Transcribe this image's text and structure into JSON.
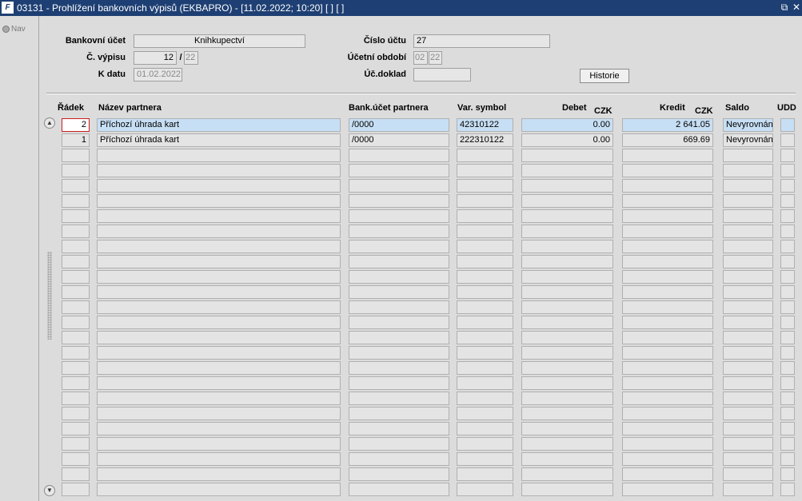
{
  "window": {
    "title": "03131 - Prohlížení bankovních výpisů (EKBAPRO) - [11.02.2022; 10:20]  [ ]  [ ]",
    "logo": "F",
    "icons": [
      "restore-icon",
      "close-icon"
    ]
  },
  "nav": {
    "label": "Nav"
  },
  "form": {
    "bank_account_label": "Bankovní účet",
    "bank_account_value": "Knihkupectví",
    "account_number_label": "Číslo účtu",
    "account_number_value": "27",
    "statement_no_label": "Č. výpisu",
    "statement_no_value": "12",
    "statement_slash": "/",
    "statement_year_value": "22",
    "period_label": "Účetní období",
    "period_month_value": "02",
    "period_year_value": "22",
    "date_label": "K datu",
    "date_value": "01.02.2022",
    "doc_label": "Úč.doklad",
    "doc_value": "",
    "history_button": "Historie"
  },
  "table": {
    "headers": {
      "row": "Řádek",
      "partner_name": "Název partnera",
      "partner_account": "Bank.účet partnera",
      "var_symbol": "Var. symbol",
      "debit": "Debet",
      "debit_currency": "CZK",
      "credit": "Kredit",
      "credit_currency": "CZK",
      "balance": "Saldo",
      "udd": "UDD"
    },
    "rows": [
      {
        "row": "2",
        "partner_name": "Příchozí úhrada kart",
        "partner_account": "/0000",
        "var_symbol": "42310122",
        "debit": "0.00",
        "credit": "2 641.05",
        "balance": "Nevyrovnán",
        "udd": ""
      },
      {
        "row": "1",
        "partner_name": "Příchozí úhrada kart",
        "partner_account": "/0000",
        "var_symbol": "222310122",
        "debit": "0.00",
        "credit": "669.69",
        "balance": "Nevyrovnán",
        "udd": ""
      }
    ]
  },
  "colors": {
    "titlebar": "#1e3f73",
    "selected_row": "#c7dff4",
    "current_cell_border": "#c81e1e",
    "background": "#dcdcdc"
  }
}
